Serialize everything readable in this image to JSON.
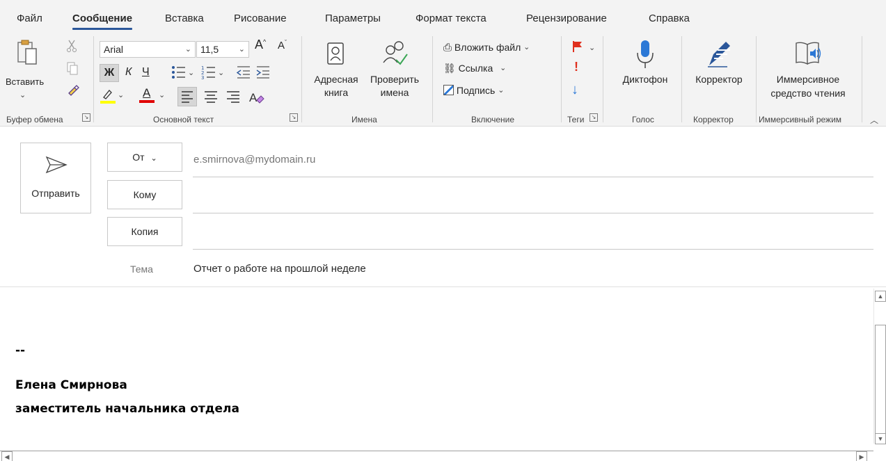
{
  "tabs": [
    "Файл",
    "Сообщение",
    "Вставка",
    "Рисование",
    "Параметры",
    "Формат текста",
    "Рецензирование",
    "Справка"
  ],
  "active_tab": "Сообщение",
  "clipboard": {
    "paste_label": "Вставить",
    "group_label": "Буфер обмена"
  },
  "basic_text": {
    "font_name": "Arial",
    "font_size": "11,5",
    "bold": "Ж",
    "italic": "К",
    "underline": "Ч",
    "grow": "A",
    "shrink": "A",
    "group_label": "Основной текст"
  },
  "names": {
    "address_book": [
      "Адресная",
      "книга"
    ],
    "check_names": [
      "Проверить",
      "имена"
    ],
    "group_label": "Имена"
  },
  "include": {
    "attach_file": "Вложить файл",
    "link": "Ссылка",
    "signature": "Подпись",
    "group_label": "Включение"
  },
  "tags": {
    "group_label": "Теги"
  },
  "voice": {
    "dictate": "Диктофон",
    "group_label": "Голос"
  },
  "editor": {
    "label": "Корректор",
    "group_label": "Корректор"
  },
  "immersive": {
    "label": [
      "Иммерсивное",
      "средство чтения"
    ],
    "group_label": "Иммерсивный режим"
  },
  "header": {
    "send_label": "Отправить",
    "from_label": "От",
    "from_value": "e.smirnova@mydomain.ru",
    "to_label": "Кому",
    "cc_label": "Копия",
    "subject_label": "Тема",
    "subject_value": "Отчет о работе на прошлой неделе"
  },
  "body": {
    "sig_separator": "--",
    "sig_name": "Елена Смирнова",
    "sig_title": "заместитель начальника отдела"
  },
  "colors": {
    "accent": "#2b579a",
    "highlight": "#ffff00",
    "font_color": "#e00000",
    "flag": "#e0301e",
    "mic": "#2b78d6"
  }
}
